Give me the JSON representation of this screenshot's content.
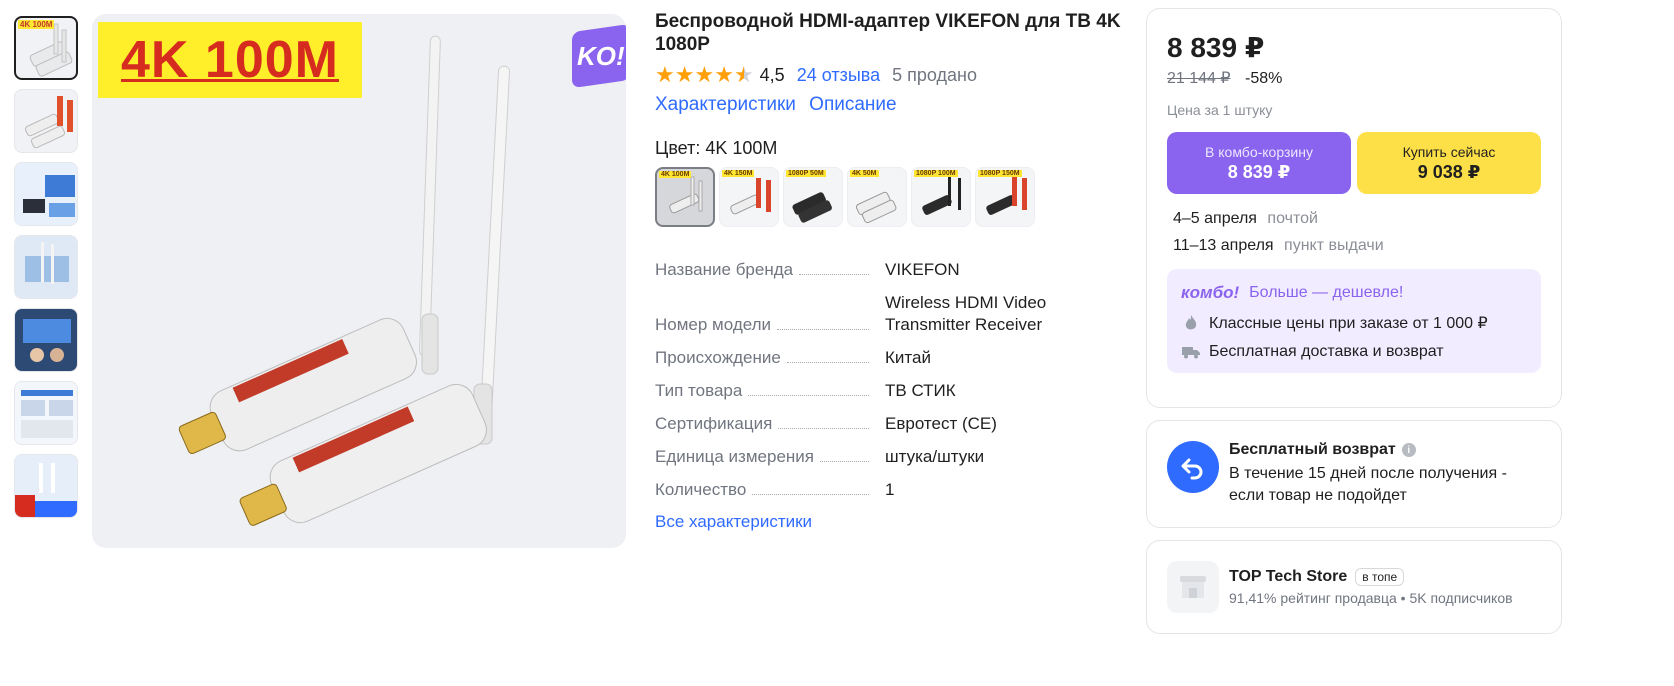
{
  "thumbnails": [
    {
      "label": "4K 100M"
    },
    {
      "label": ""
    },
    {
      "label": ""
    },
    {
      "label": ""
    },
    {
      "label": ""
    },
    {
      "label": ""
    },
    {
      "label": ""
    }
  ],
  "main_image": {
    "banner": "4K 100M",
    "badge": "KO!"
  },
  "product": {
    "title": "Беспроводной HDMI-адаптер VIKEFON для ТВ 4K 1080P",
    "rating": "4,5",
    "rating_value": 4.5,
    "reviews": "24 отзыва",
    "sold": "5 продано",
    "links": [
      "Характеристики",
      "Описание"
    ],
    "color_label": "Цвет: 4K 100M",
    "swatches": [
      "4K 100M",
      "4K 150M",
      "1080P 50M",
      "4K 50M",
      "1080P 100M",
      "1080P 150M"
    ],
    "specs": [
      {
        "key": "Название бренда",
        "value": "VIKEFON"
      },
      {
        "key": "Номер модели",
        "value": "Wireless HDMI Video Transmitter Receiver"
      },
      {
        "key": "Происхождение",
        "value": "Китай"
      },
      {
        "key": "Тип товара",
        "value": "ТВ СТИК"
      },
      {
        "key": "Сертификация",
        "value": "Евротест (CE)"
      },
      {
        "key": "Единица измерения",
        "value": "штука/штуки"
      },
      {
        "key": "Количество",
        "value": "1"
      }
    ],
    "all_specs": "Все характеристики"
  },
  "buy": {
    "price": "8 839 ₽",
    "old_price": "21 144 ₽",
    "discount": "-58%",
    "per_unit": "Цена за 1 штуку",
    "combo_btn_title": "В комбо-корзину",
    "combo_btn_price": "8 839 ₽",
    "buy_btn_title": "Купить сейчас",
    "buy_btn_price": "9 038 ₽",
    "delivery": [
      {
        "date": "4–5 апреля",
        "method": "почтой"
      },
      {
        "date": "11–13 апреля",
        "method": "пункт выдачи"
      }
    ],
    "combo": {
      "logo": "комбо!",
      "tagline": "Больше — дешевле!",
      "line1": "Классные цены при заказе от 1 000 ₽",
      "line2": "Бесплатная доставка и возврат"
    }
  },
  "return": {
    "title": "Бесплатный возврат",
    "text": "В течение 15 дней после получения - если товар не подойдет"
  },
  "store": {
    "name": "TOP Tech Store",
    "badge": "в топе",
    "meta": "91,41% рейтинг продавца  •  5K подписчиков"
  },
  "colors": {
    "accent_blue": "#2f6bff",
    "combo_purple": "#8a63ee",
    "buy_yellow": "#fde047",
    "star_orange": "#ff9f0a"
  }
}
